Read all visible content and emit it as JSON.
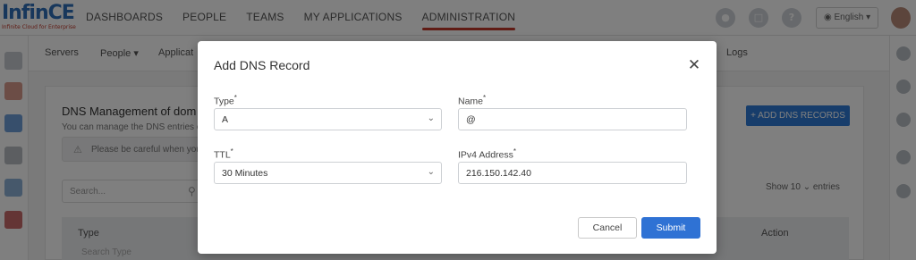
{
  "app": {
    "logo_text": "InfinCE",
    "logo_tagline": "Infinite Cloud for Enterprise"
  },
  "top_nav": [
    {
      "label": "DASHBOARDS"
    },
    {
      "label": "PEOPLE"
    },
    {
      "label": "TEAMS"
    },
    {
      "label": "MY APPLICATIONS"
    },
    {
      "label": "ADMINISTRATION"
    }
  ],
  "language": "English",
  "sub_nav": [
    {
      "label": "Servers"
    },
    {
      "label": "People"
    },
    {
      "label": "Applicat"
    },
    {
      "label": "Logs"
    }
  ],
  "page": {
    "title": "DNS Management of dom",
    "subtitle": "You can manage the DNS entries o",
    "warning": "Please be careful when you",
    "add_button": "+ ADD DNS RECORDS",
    "search_placeholder": "Search...",
    "show_label": "Show 10",
    "entries_label": "entries",
    "table_headers": [
      {
        "label": "Type",
        "filter": "Search Type"
      },
      {
        "label": "Action",
        "filter": ""
      }
    ]
  },
  "modal": {
    "title": "Add DNS Record",
    "close_icon": "close-icon",
    "type_label": "Type",
    "type_value": "A",
    "name_label": "Name",
    "name_value": "@",
    "ttl_label": "TTL",
    "ttl_value": "30 Minutes",
    "ipv4_label": "IPv4 Address",
    "ipv4_value": "216.150.142.40",
    "required_mark": "*",
    "cancel_label": "Cancel",
    "submit_label": "Submit"
  },
  "colors": {
    "accent": "#2f72d4",
    "brand_red": "#c0392b",
    "overlay": "rgba(0,0,0,0.5)"
  }
}
